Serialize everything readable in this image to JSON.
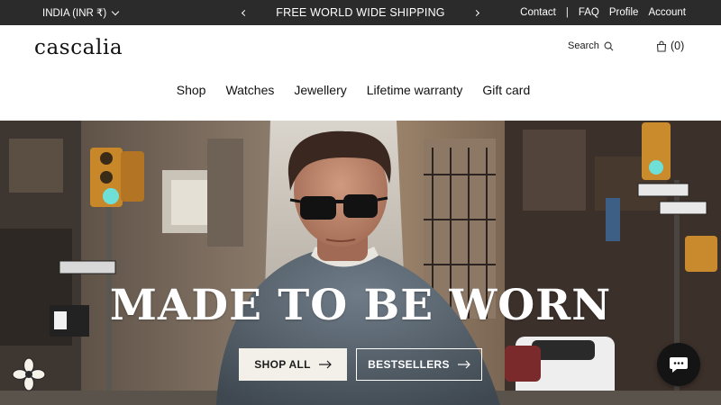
{
  "announcement": {
    "region": "INDIA (INR ₹)",
    "promo": "FREE WORLD WIDE SHIPPING",
    "links": {
      "contact": "Contact",
      "separator": "|",
      "faq": "FAQ",
      "profile": "Profile",
      "account": "Account"
    }
  },
  "header": {
    "logo": "cascalia",
    "search_label": "Search",
    "cart_count": "(0)"
  },
  "nav": {
    "items": [
      "Shop",
      "Watches",
      "Jewellery",
      "Lifetime warranty",
      "Gift card"
    ]
  },
  "hero": {
    "headline": "MADE TO BE WORN",
    "buttons": {
      "shop_all": "SHOP ALL",
      "bestsellers": "BESTSELLERS"
    }
  },
  "colors": {
    "topbar": "#2b2b2b",
    "shop_all_bg": "#f3f0ea",
    "chat_bg": "#141414"
  },
  "icons": [
    "chevron-down-icon",
    "chevron-left-icon",
    "chevron-right-icon",
    "search-icon",
    "bag-icon",
    "arrow-right-icon",
    "flower-badge-icon",
    "chat-icon"
  ]
}
